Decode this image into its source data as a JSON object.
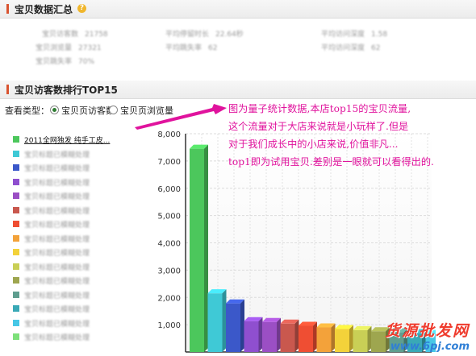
{
  "summary": {
    "title": "宝贝数据汇总",
    "help_icon": "help-icon",
    "stats": [
      {
        "label": "宝贝访客数",
        "value": "21758"
      },
      {
        "label": "平均停留时长",
        "value": "22.64秒"
      },
      {
        "label": "平均访问深度",
        "value": "1.58"
      },
      {
        "label": "宝贝浏览量",
        "value": "27321"
      },
      {
        "label": "平均跳失率",
        "value": "62"
      },
      {
        "label": "平均访问深度",
        "value": "62"
      },
      {
        "label": "宝贝跳失率",
        "value": "70%"
      }
    ]
  },
  "ranking": {
    "title": "宝贝访客数排行TOP15",
    "view_type_label": "查看类型：",
    "options": [
      {
        "label": "宝贝页访客数",
        "selected": true
      },
      {
        "label": "宝贝页浏览量",
        "selected": false
      }
    ],
    "legend": [
      {
        "label": "2011全网独发 纯手工皮...",
        "color": "#4cc75c"
      },
      {
        "label": "宝贝标题已模糊处理",
        "color": "#3fc9d6"
      },
      {
        "label": "宝贝标题已模糊处理",
        "color": "#3b58c9"
      },
      {
        "label": "宝贝标题已模糊处理",
        "color": "#8f4fcf"
      },
      {
        "label": "宝贝标题已模糊处理",
        "color": "#9b4fc4"
      },
      {
        "label": "宝贝标题已模糊处理",
        "color": "#c9584e"
      },
      {
        "label": "宝贝标题已模糊处理",
        "color": "#ef4e33"
      },
      {
        "label": "宝贝标题已模糊处理",
        "color": "#f3a23a"
      },
      {
        "label": "宝贝标题已模糊处理",
        "color": "#f3d23a"
      },
      {
        "label": "宝贝标题已模糊处理",
        "color": "#c9cf56"
      },
      {
        "label": "宝贝标题已模糊处理",
        "color": "#9ea64f"
      },
      {
        "label": "宝贝标题已模糊处理",
        "color": "#5f9e8f"
      },
      {
        "label": "宝贝标题已模糊处理",
        "color": "#39a9b6"
      },
      {
        "label": "宝贝标题已模糊处理",
        "color": "#47c7e6"
      },
      {
        "label": "宝贝标题已模糊处理",
        "color": "#7de07a"
      }
    ]
  },
  "annotation": {
    "lines": [
      "图为量子统计数据,本店top15的宝贝流量,",
      "这个流量对于大店来说就是小玩样了.但是",
      "对于我们成长中的小店来说,价值非凡...",
      "top1即为试用宝贝.差别是一眼就可以看得出的."
    ],
    "color": "#e0139d"
  },
  "watermark": {
    "text": "货源批发网",
    "url": "www.6pj.com"
  },
  "chart_data": {
    "type": "bar",
    "ylim": [
      0,
      8000
    ],
    "yticks": [
      "8,000",
      "7,000",
      "6,000",
      "5,000",
      "4,000",
      "3,000",
      "2,000",
      "1,000"
    ],
    "values": [
      7450,
      2150,
      1780,
      1130,
      1100,
      1040,
      960,
      900,
      840,
      800,
      760,
      720,
      690,
      660,
      620
    ],
    "colors": [
      "#4cc75c",
      "#3fc9d6",
      "#3b58c9",
      "#8f4fcf",
      "#9b4fc4",
      "#c9584e",
      "#ef4e33",
      "#f3a23a",
      "#f3d23a",
      "#c9cf56",
      "#9ea64f",
      "#5f9e8f",
      "#39a9b6",
      "#47c7e6",
      "#7de07a"
    ]
  }
}
